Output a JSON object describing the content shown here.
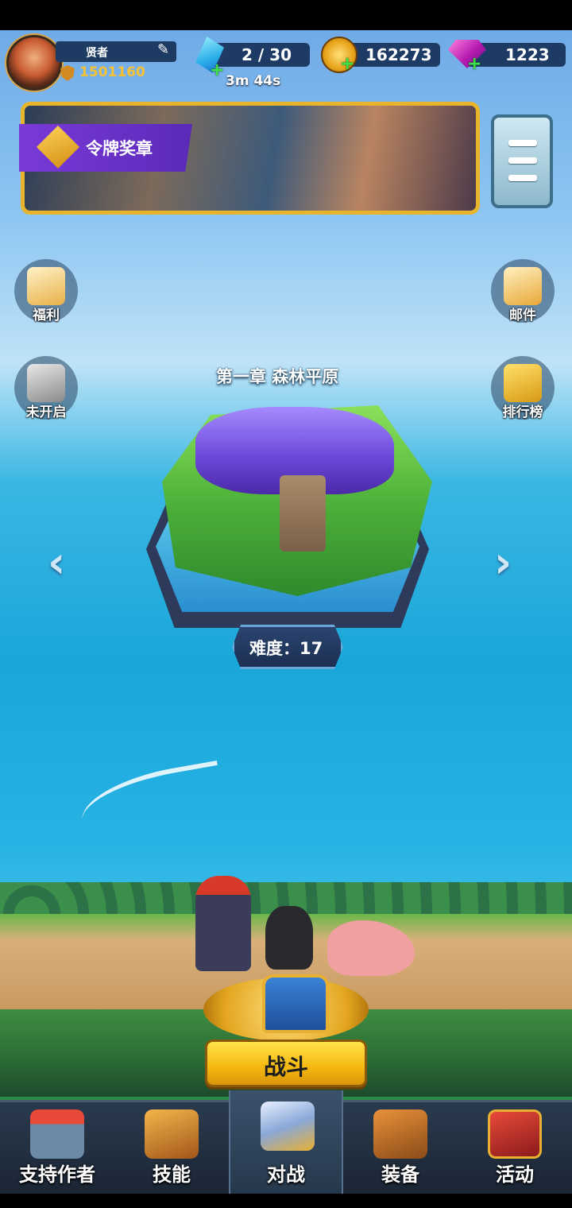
{
  "player": {
    "name": "贤者",
    "power": "1501160"
  },
  "resources": {
    "energy": "2 / 30",
    "energy_timer": "3m 44s",
    "gold": "162273",
    "gems": "1223"
  },
  "banner": {
    "label": "令牌奖章"
  },
  "side_left": [
    {
      "label": "福利",
      "icon": "gift-scroll-icon"
    },
    {
      "label": "未开启",
      "icon": "locked-trophy-icon"
    }
  ],
  "side_right": [
    {
      "label": "邮件",
      "icon": "mail-icon"
    },
    {
      "label": "排行榜",
      "icon": "ranking-podium-icon"
    }
  ],
  "stage": {
    "chapter": "第一章  森林平原",
    "difficulty": "难度：17"
  },
  "fight_button": "战斗",
  "nav": [
    {
      "label": "支持作者",
      "icon": "shop-icon"
    },
    {
      "label": "技能",
      "icon": "skill-book-icon"
    },
    {
      "label": "对战",
      "icon": "battle-shield-icon"
    },
    {
      "label": "装备",
      "icon": "equipment-bag-icon"
    },
    {
      "label": "活动",
      "icon": "event-badge-icon"
    }
  ],
  "colors": {
    "accent_gold": "#e7b42c",
    "nav_bg": "#1a2534",
    "power": "#f6c233",
    "plus": "#3ee04a"
  }
}
